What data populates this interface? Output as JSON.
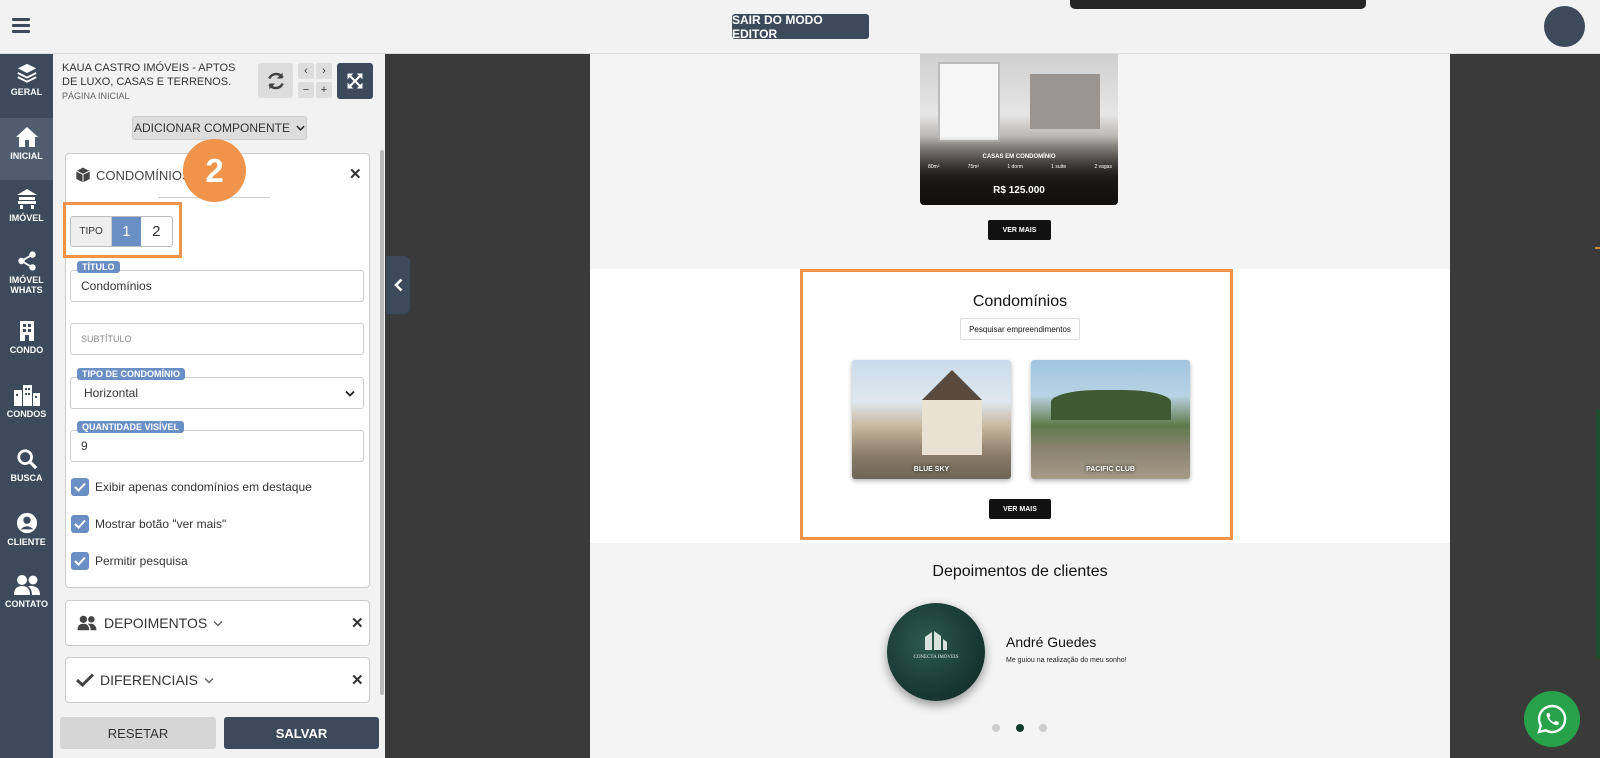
{
  "topbar": {
    "exit_editor_label": "SAIR DO MODO EDITOR"
  },
  "nav": {
    "items": [
      {
        "label": "GERAL",
        "icon": "layers-icon"
      },
      {
        "label": "INICIAL",
        "icon": "home-icon"
      },
      {
        "label": "IMÓVEL",
        "icon": "house-icon"
      },
      {
        "label": "IMÓVEL WHATS",
        "icon": "share-icon"
      },
      {
        "label": "CONDO",
        "icon": "building-icon"
      },
      {
        "label": "CONDOS",
        "icon": "city-icon"
      },
      {
        "label": "BUSCA",
        "icon": "search-icon"
      },
      {
        "label": "CLIENTE",
        "icon": "user-circle-icon"
      },
      {
        "label": "CONTATO",
        "icon": "users-icon"
      }
    ],
    "active": "INICIAL"
  },
  "panel": {
    "site_name": "KAUA CASTRO IMÓVEIS - APTOS DE LUXO, CASAS E TERRENOS.",
    "page_name": "PÁGINA INICIAL",
    "add_component_label": "ADICIONAR COMPONENTE",
    "step_badge": "2",
    "component": {
      "title": "CONDOMÍNIOS",
      "tipo_label": "TIPO",
      "tipo_options": [
        "1",
        "2"
      ],
      "tipo_selected": "1",
      "titulo_label": "TÍTULO",
      "titulo_value": "Condomínios",
      "subtitulo_placeholder": "SUBTÍTULO",
      "tipo_condominio_label": "TIPO DE CONDOMÍNIO",
      "tipo_condominio_value": "Horizontal",
      "quantidade_label": "QUANTIDADE VISÍVEL",
      "quantidade_value": "9",
      "checkboxes": [
        {
          "label": "Exibir apenas condomínios em destaque",
          "checked": true
        },
        {
          "label": "Mostrar botão \"ver mais\"",
          "checked": true
        },
        {
          "label": "Permitir pesquisa",
          "checked": true
        }
      ]
    },
    "collapsed_sections": [
      {
        "title": "DEPOIMENTOS",
        "icon": "users-icon"
      },
      {
        "title": "DIFERENCIAIS",
        "icon": "check-icon"
      }
    ],
    "reset_label": "RESETAR",
    "save_label": "SALVAR"
  },
  "preview": {
    "property": {
      "type": "CASAS EM CONDOMÍNIO",
      "features": [
        "80m²",
        "75m²",
        "1 dorm",
        "1 suíte",
        "2 vagas"
      ],
      "price": "R$ 125.000",
      "button": "VER MAIS"
    },
    "condominios": {
      "title": "Condomínios",
      "search_button": "Pesquisar empreendimentos",
      "cards": [
        "BLUE SKY",
        "PACIFIC CLUB"
      ],
      "button": "VER MAIS"
    },
    "depoimentos": {
      "title": "Depoimentos de clientes",
      "name": "André Guedes",
      "quote": "Me guiou na realização do meu sonho!",
      "logo_text": "CONECTA IMÓVEIS",
      "dots": 3,
      "active_dot": 2
    }
  },
  "colors": {
    "sidebar": "#3c4a5c",
    "highlight": "#f0944c",
    "accent": "#6a8fc4",
    "whatsapp": "#27a14a"
  }
}
